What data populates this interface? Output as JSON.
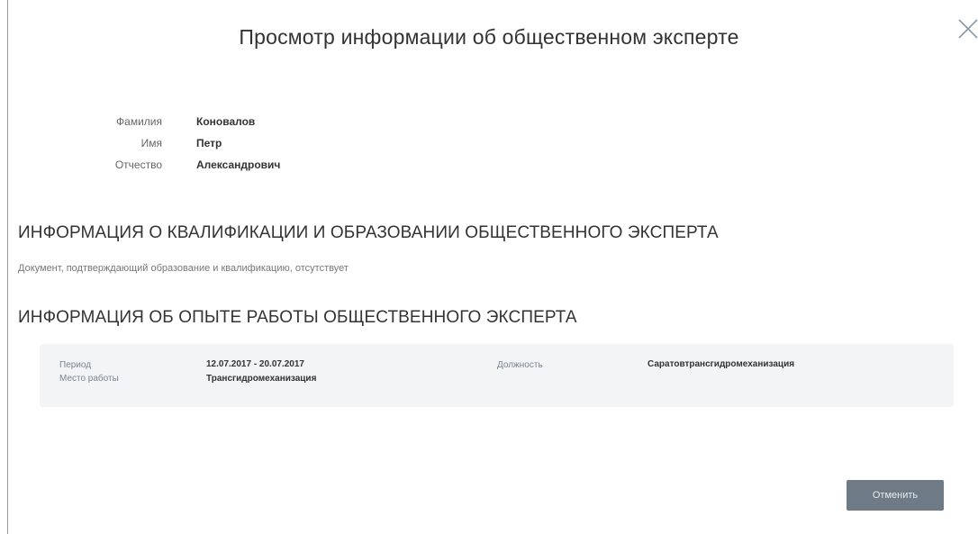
{
  "dialog": {
    "title": "Просмотр информации об общественном эксперте"
  },
  "person": {
    "surname_label": "Фамилия",
    "surname_value": "Коновалов",
    "name_label": "Имя",
    "name_value": "Петр",
    "patronymic_label": "Отчество",
    "patronymic_value": "Александрович"
  },
  "qualification": {
    "heading": "ИНФОРМАЦИЯ О КВАЛИФИКАЦИИ И ОБРАЗОВАНИИ ОБЩЕСТВЕННОГО ЭКСПЕРТА",
    "note": "Документ, подтверждающий образование и квалификацию, отсутствует"
  },
  "experience": {
    "heading": "ИНФОРМАЦИЯ ОБ ОПЫТЕ РАБОТЫ ОБЩЕСТВЕННОГО ЭКСПЕРТА",
    "entries": [
      {
        "period_label": "Период",
        "period_value": "12.07.2017  -  20.07.2017",
        "workplace_label": "Место работы",
        "workplace_value": "Трансгидромеханизация",
        "position_label": "Должность",
        "position_value": "Саратовтрансгидромеханизация"
      }
    ]
  },
  "footer": {
    "cancel_label": "Отменить"
  },
  "icons": {
    "close": "close-icon"
  }
}
